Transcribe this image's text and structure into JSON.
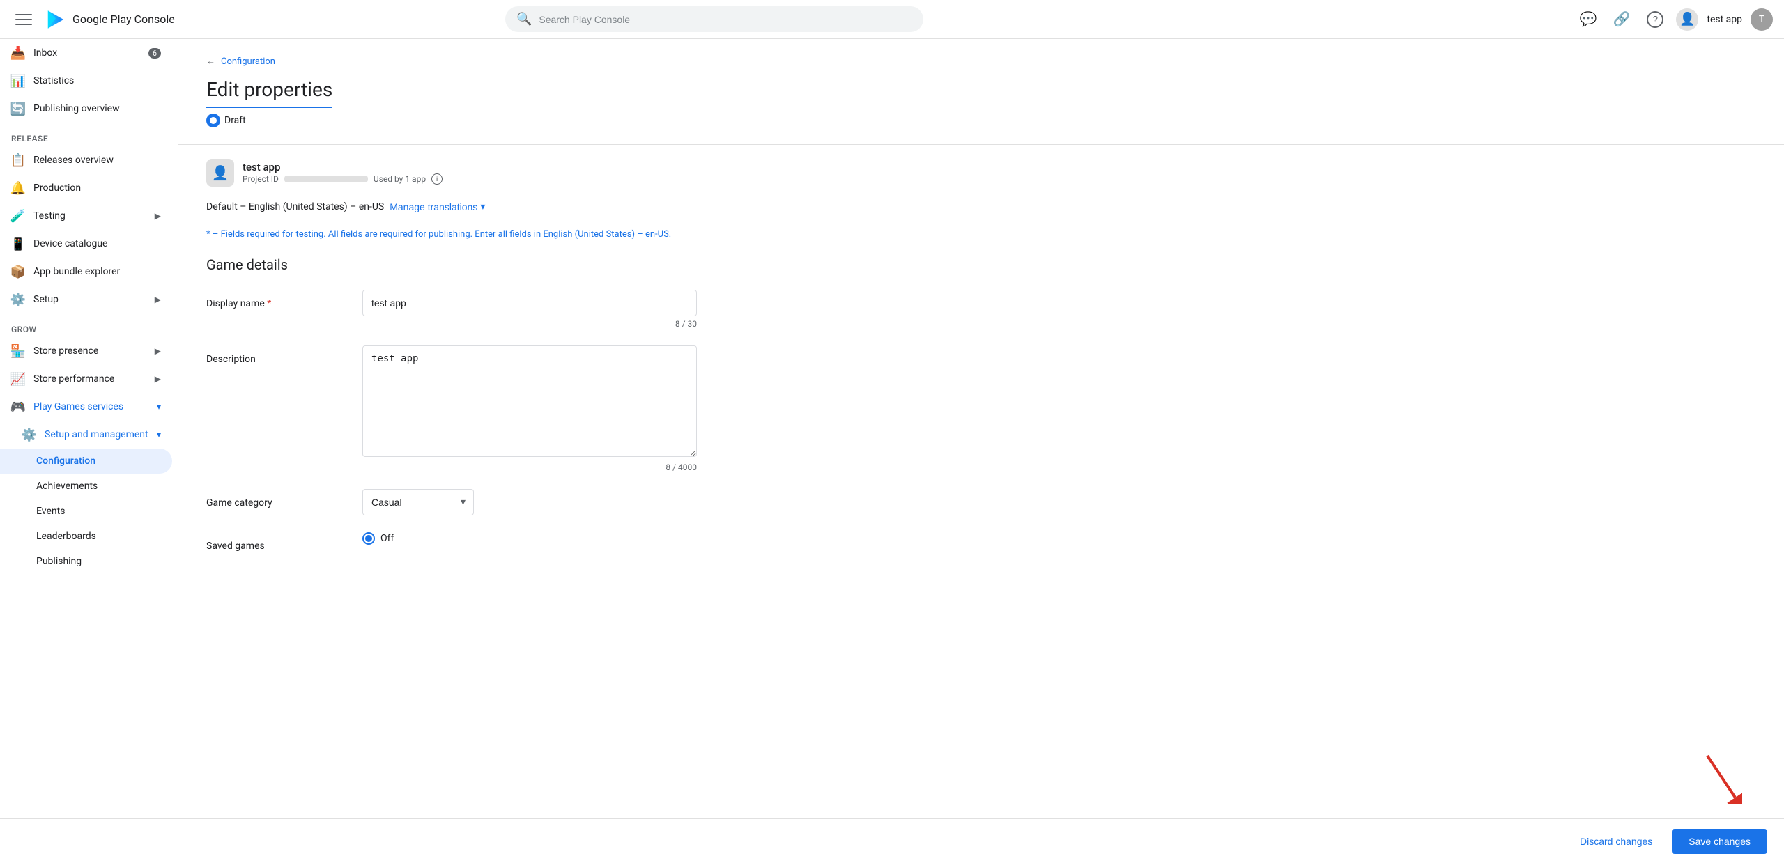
{
  "topbar": {
    "logo_text": "Google Play Console",
    "search_placeholder": "Search Play Console",
    "user_name": "test app",
    "comment_icon": "💬",
    "link_icon": "🔗",
    "help_icon": "?"
  },
  "sidebar": {
    "inbox_label": "Inbox",
    "inbox_badge": "6",
    "statistics_label": "Statistics",
    "publishing_overview_label": "Publishing overview",
    "release_section_label": "Release",
    "releases_overview_label": "Releases overview",
    "production_label": "Production",
    "testing_label": "Testing",
    "device_catalogue_label": "Device catalogue",
    "app_bundle_explorer_label": "App bundle explorer",
    "setup_label": "Setup",
    "grow_section_label": "Grow",
    "store_presence_label": "Store presence",
    "store_performance_label": "Store performance",
    "play_games_services_label": "Play Games services",
    "setup_and_management_label": "Setup and management",
    "configuration_label": "Configuration",
    "achievements_label": "Achievements",
    "events_label": "Events",
    "leaderboards_label": "Leaderboards",
    "publishing_label": "Publishing"
  },
  "breadcrumb": {
    "text": "Configuration",
    "arrow": "←"
  },
  "page": {
    "title": "Edit properties",
    "draft_label": "Draft",
    "app_name": "test app",
    "project_label": "Project ID",
    "used_by_label": "Used by 1 app",
    "lang_default": "Default – English (United States) – en-US",
    "manage_translations": "Manage translations",
    "required_note": "* – Fields required for testing. All fields are required for publishing. Enter all fields in English (United States) – en-US.",
    "game_details_title": "Game details",
    "display_name_label": "Display name",
    "display_name_required": "*",
    "display_name_value": "test app",
    "display_name_count": "8 / 30",
    "description_label": "Description",
    "description_value": "test app",
    "description_count": "8 / 4000",
    "game_category_label": "Game category",
    "game_category_value": "Casual",
    "saved_games_label": "Saved games",
    "saved_games_value": "Off"
  },
  "footer": {
    "discard_label": "Discard changes",
    "save_label": "Save changes"
  }
}
